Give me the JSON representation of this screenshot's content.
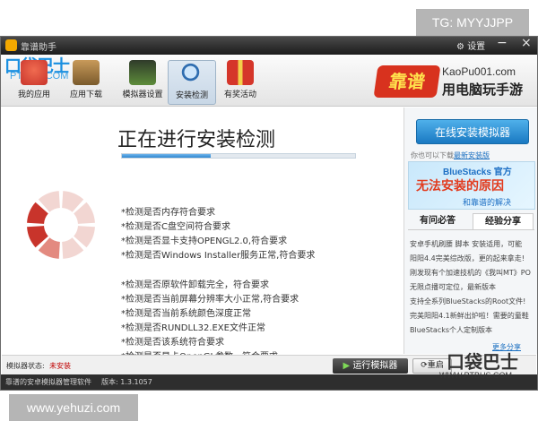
{
  "watermark_top": "TG: MYYJJPP",
  "watermark_bottom": "www.yehuzi.com",
  "window": {
    "title": "靠谱助手",
    "settings_label": "设置",
    "minimize_glyph": "−",
    "close_glyph": "×"
  },
  "brand": {
    "logo": "口袋巴士",
    "sub": "PTBUS.COM"
  },
  "nav": [
    {
      "label": "我的应用",
      "icon": "my-apps-icon",
      "color": "#d63a2a"
    },
    {
      "label": "应用下载",
      "icon": "download-icon",
      "color": "#7a5a2c"
    },
    {
      "label": "模拟器设置",
      "icon": "emulator-settings-icon",
      "color": "#3a6b2a"
    },
    {
      "label": "安装检测",
      "icon": "magnifier-icon",
      "color": "#2f6db0"
    },
    {
      "label": "有奖活动",
      "icon": "gift-icon",
      "color": "#d5362a"
    }
  ],
  "kaopu": {
    "mark": "靠谱",
    "url": "KaoPu001.com",
    "slogan": "用电脑玩手游"
  },
  "main": {
    "title": "正在进行安装检测",
    "progress": 0.38,
    "checks_group1": [
      "*检测是否内存符合要求",
      "*检测是否C盘空间符合要求",
      "*检测是否显卡支持OPENGL2.0,符合要求",
      "*检测是否Windows Installer服务正常,符合要求"
    ],
    "checks_group2": [
      "*检测是否原软件卸载完全，符合要求",
      "*检测是否当前屏幕分辨率大小正常,符合要求",
      "*检测是否当前系统颜色深度正常",
      "*检测是否RUNDLL32.EXE文件正常",
      "*检测是否该系统符合要求",
      "*检测是否显卡OpenGL参数，符合要求"
    ],
    "donut_colors": {
      "done": "#c8342b",
      "mid": "#e38a80",
      "pending": "#f2d6d2"
    }
  },
  "right": {
    "install_button": "在线安装模拟器",
    "hint_prefix": "你也可以下载",
    "hint_link": "最新安装版",
    "ad_line1": "BlueStacks 官方",
    "ad_line2": "无法安装的原因",
    "ad_line3": "和靠谱的解决",
    "tab_qa": "有问必答",
    "tab_exp": "经验分享",
    "exp_items": [
      "安卓手机刷腰 脚本 安装适用，可能",
      "阳阳4.4完美综改版，更的起来拿走!",
      "刚发现有个加速技机的《我叫MT》PO",
      "无限点播可定位，最新版本",
      "支持全系列BlueStacks的Root文件!",
      "完美阳阳4.1新鲜出炉啦！需要的童鞋",
      "BlueStacks个人定制版本"
    ],
    "more_link": "更多分享"
  },
  "status": {
    "label": "模拟器状态:",
    "value": "未安装",
    "run_button": "运行模拟器",
    "restart_button": "重启"
  },
  "footer": {
    "title": "靠谱的安卓模拟器管理软件",
    "version": "版本: 1.3.1057"
  },
  "ptbus": {
    "name": "口袋巴士",
    "url": "WWW.PTBUS.COM"
  }
}
